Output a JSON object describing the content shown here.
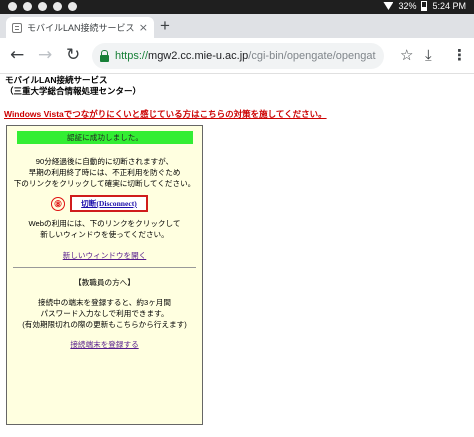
{
  "status_bar": {
    "battery": "32%",
    "time": "5:24 PM"
  },
  "tab": {
    "title": "モバイルLAN接続サービス -",
    "close": "×",
    "new_tab": "+"
  },
  "toolbar": {
    "back": "←",
    "forward": "→",
    "reload": "↻",
    "url": {
      "scheme": "https://",
      "host": "mgw2.cc.mie-u.ac.jp",
      "path": "/cgi-bin/opengate/opengatesrv.cgi"
    },
    "bookmark": "☆",
    "download": "⤓",
    "menu": "⋮"
  },
  "page": {
    "title_line1": "モバイルLAN接続サービス",
    "title_line2": "（三重大学総合情報処理センター）",
    "vista_link": "Windows Vistaでつながりにくいと感じている方はこちらの対策を施してください。",
    "success_msg": "認証に成功しました。",
    "info_lines": [
      "90分経過後に自動的に切断されますが、",
      "早期の利用終了時には、不正利用を防ぐため",
      "下のリンクをクリックして確実に切断してください。"
    ],
    "step_number": "⑧",
    "disconnect_link": "切断(Disconnect)",
    "web_note_lines": [
      "Webの利用には、下のリンクをクリックして",
      "新しいウィンドウを使ってください。"
    ],
    "new_window_link": "新しいウィンドウを開く",
    "staff_heading": "【教職員の方へ】",
    "staff_note_lines": [
      "接続中の端末を登録すると、約3ヶ月間",
      "パスワード入力なしで利用できます。",
      "(有効期限切れの際の更新もこちらから行えます)"
    ],
    "register_link": "接続端末を登録する"
  },
  "colors": {
    "success_bg": "#33ee33",
    "panel_bg": "#ffffe0",
    "warning_link": "#cc0000",
    "highlight_box": "#d01c1c"
  }
}
